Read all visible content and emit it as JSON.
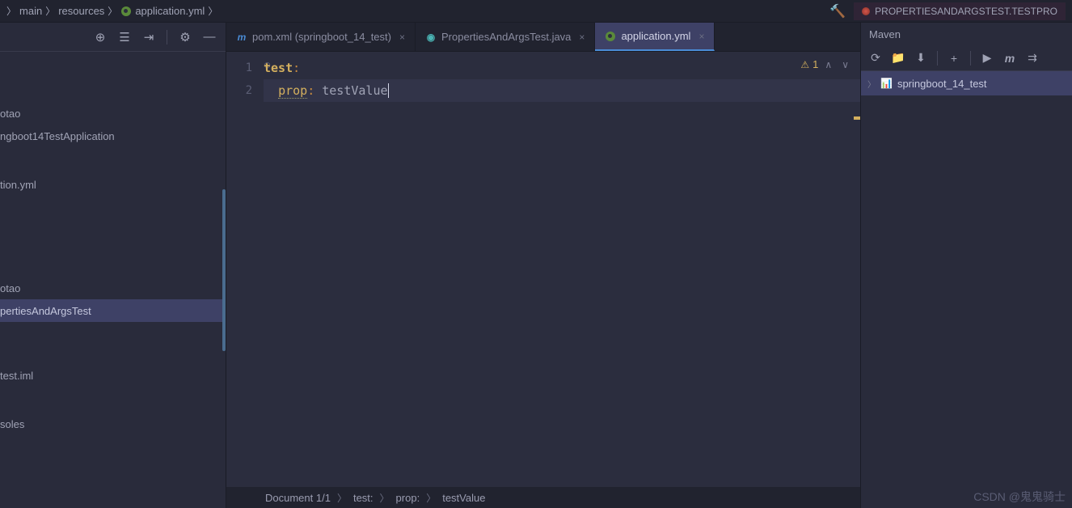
{
  "breadcrumb": {
    "items": [
      "main",
      "resources",
      "application.yml"
    ]
  },
  "topRight": {
    "testLabel": "PROPERTIESANDARGSTEST.TESTPRO"
  },
  "sidebar": {
    "items": [
      "otao",
      "ngboot14TestApplication",
      "tion.yml",
      "otao",
      "pertiesAndArgsTest",
      "test.iml",
      "soles"
    ]
  },
  "tabs": [
    {
      "label": "pom.xml (springboot_14_test)",
      "icon": "maven",
      "active": false
    },
    {
      "label": "PropertiesAndArgsTest.java",
      "icon": "java",
      "active": false
    },
    {
      "label": "application.yml",
      "icon": "yml",
      "active": true
    }
  ],
  "editor": {
    "lines": [
      {
        "num": "1",
        "key": "test",
        "val": "",
        "indent": ""
      },
      {
        "num": "2",
        "key": "prop",
        "val": "testValue",
        "indent": "  "
      }
    ],
    "warningCount": "1"
  },
  "statusBar": {
    "doc": "Document 1/1",
    "path": [
      "test:",
      "prop:",
      "testValue"
    ]
  },
  "rightPanel": {
    "title": "Maven",
    "project": "springboot_14_test"
  },
  "watermark": "CSDN @鬼鬼骑士"
}
